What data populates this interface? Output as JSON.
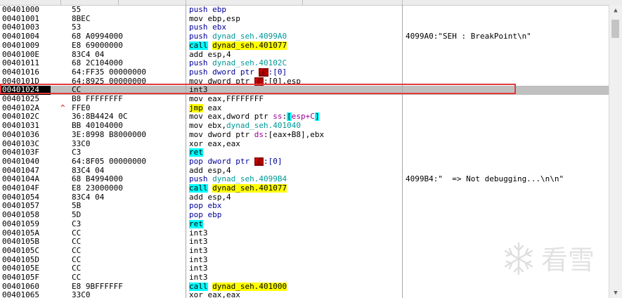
{
  "watermark": {
    "text": "看雪"
  },
  "rows": [
    {
      "addr": "00401000",
      "bytes": "55",
      "instr": [
        {
          "t": "push ebp",
          "c": "t-push"
        }
      ],
      "comment": ""
    },
    {
      "addr": "00401001",
      "bytes": "8BEC",
      "instr": [
        {
          "t": "mov ebp,esp",
          "c": "t-kw"
        }
      ],
      "comment": ""
    },
    {
      "addr": "00401003",
      "bytes": "53",
      "instr": [
        {
          "t": "push ebx",
          "c": "t-push"
        }
      ],
      "comment": ""
    },
    {
      "addr": "00401004",
      "bytes": "68 A0994000",
      "instr": [
        {
          "t": "push ",
          "c": "t-push"
        },
        {
          "t": "dynad_seh.4099A0",
          "c": "t-pushop"
        }
      ],
      "comment": "4099A0:\"SEH : BreakPoint\\n\""
    },
    {
      "addr": "00401009",
      "bytes": "E8 69000000",
      "instr": [
        {
          "t": "call",
          "c": "t-call"
        },
        {
          "t": " ",
          "c": ""
        },
        {
          "t": "dynad_seh.401077",
          "c": "t-dyn"
        }
      ],
      "comment": ""
    },
    {
      "addr": "0040100E",
      "bytes": "83C4 04",
      "instr": [
        {
          "t": "add esp,4",
          "c": "t-kw"
        }
      ],
      "comment": ""
    },
    {
      "addr": "00401011",
      "bytes": "68 2C104000",
      "instr": [
        {
          "t": "push ",
          "c": "t-push"
        },
        {
          "t": "dynad_seh.40102C",
          "c": "t-pushop"
        }
      ],
      "comment": ""
    },
    {
      "addr": "00401016",
      "bytes": "64:FF35 00000000",
      "instr": [
        {
          "t": "push dword ptr ",
          "c": "t-push"
        },
        {
          "t": "fs",
          "c": "t-seg"
        },
        {
          "t": ":[0]",
          "c": "t-push"
        }
      ],
      "comment": ""
    },
    {
      "addr": "0040101D",
      "bytes": "64:8925 00000000",
      "instr": [
        {
          "t": "mov dword ptr ",
          "c": "t-kw"
        },
        {
          "t": "fs",
          "c": "t-seg"
        },
        {
          "t": ":[0],esp",
          "c": "t-kw"
        }
      ],
      "comment": ""
    },
    {
      "addr": "00401024",
      "bytes": "CC",
      "instr": [
        {
          "t": "int3",
          "c": "t-kw"
        }
      ],
      "comment": "",
      "selected": true
    },
    {
      "addr": "00401025",
      "bytes": "B8 FFFFFFFF",
      "instr": [
        {
          "t": "mov eax,FFFFFFFF",
          "c": "t-kw"
        }
      ],
      "comment": ""
    },
    {
      "addr": "0040102A",
      "mark": "^",
      "bytes": "FFE0",
      "instr": [
        {
          "t": "jmp",
          "c": "t-jmp"
        },
        {
          "t": " eax",
          "c": "t-kw"
        }
      ],
      "comment": ""
    },
    {
      "addr": "0040102C",
      "bytes": "36:8B4424 0C",
      "instr": [
        {
          "t": "mov eax,dword ptr ",
          "c": "t-kw"
        },
        {
          "t": "ss",
          "c": "t-mag"
        },
        {
          "t": ":",
          "c": "t-kw"
        },
        {
          "t": "[",
          "c": "t-brk"
        },
        {
          "t": "esp+C",
          "c": "t-mag"
        },
        {
          "t": "]",
          "c": "t-brk"
        }
      ],
      "comment": ""
    },
    {
      "addr": "00401031",
      "bytes": "BB 40104000",
      "instr": [
        {
          "t": "mov ebx,",
          "c": "t-kw"
        },
        {
          "t": "dynad_seh.401040",
          "c": "t-pushop"
        }
      ],
      "comment": ""
    },
    {
      "addr": "00401036",
      "bytes": "3E:8998 B8000000",
      "instr": [
        {
          "t": "mov dword ptr ",
          "c": "t-kw"
        },
        {
          "t": "ds",
          "c": "t-mag"
        },
        {
          "t": ":[eax+B8],ebx",
          "c": "t-kw"
        }
      ],
      "comment": ""
    },
    {
      "addr": "0040103C",
      "bytes": "33C0",
      "instr": [
        {
          "t": "xor eax,eax",
          "c": "t-kw"
        }
      ],
      "comment": ""
    },
    {
      "addr": "0040103F",
      "bytes": "C3",
      "instr": [
        {
          "t": "ret",
          "c": "t-ret"
        }
      ],
      "comment": ""
    },
    {
      "addr": "00401040",
      "bytes": "64:8F05 00000000",
      "instr": [
        {
          "t": "pop dword ptr ",
          "c": "t-push"
        },
        {
          "t": "fs",
          "c": "t-seg"
        },
        {
          "t": ":[0]",
          "c": "t-push"
        }
      ],
      "comment": ""
    },
    {
      "addr": "00401047",
      "bytes": "83C4 04",
      "instr": [
        {
          "t": "add esp,4",
          "c": "t-kw"
        }
      ],
      "comment": ""
    },
    {
      "addr": "0040104A",
      "bytes": "68 B4994000",
      "instr": [
        {
          "t": "push ",
          "c": "t-push"
        },
        {
          "t": "dynad_seh.4099B4",
          "c": "t-pushop"
        }
      ],
      "comment": "4099B4:\"  => Not debugging...\\n\\n\""
    },
    {
      "addr": "0040104F",
      "bytes": "E8 23000000",
      "instr": [
        {
          "t": "call",
          "c": "t-call"
        },
        {
          "t": " ",
          "c": ""
        },
        {
          "t": "dynad_seh.401077",
          "c": "t-dyn"
        }
      ],
      "comment": ""
    },
    {
      "addr": "00401054",
      "bytes": "83C4 04",
      "instr": [
        {
          "t": "add esp,4",
          "c": "t-kw"
        }
      ],
      "comment": ""
    },
    {
      "addr": "00401057",
      "bytes": "5B",
      "instr": [
        {
          "t": "pop ebx",
          "c": "t-push"
        }
      ],
      "comment": ""
    },
    {
      "addr": "00401058",
      "bytes": "5D",
      "instr": [
        {
          "t": "pop ebp",
          "c": "t-push"
        }
      ],
      "comment": ""
    },
    {
      "addr": "00401059",
      "bytes": "C3",
      "instr": [
        {
          "t": "ret",
          "c": "t-ret"
        }
      ],
      "comment": ""
    },
    {
      "addr": "0040105A",
      "bytes": "CC",
      "instr": [
        {
          "t": "int3",
          "c": "t-kw"
        }
      ],
      "comment": ""
    },
    {
      "addr": "0040105B",
      "bytes": "CC",
      "instr": [
        {
          "t": "int3",
          "c": "t-kw"
        }
      ],
      "comment": ""
    },
    {
      "addr": "0040105C",
      "bytes": "CC",
      "instr": [
        {
          "t": "int3",
          "c": "t-kw"
        }
      ],
      "comment": ""
    },
    {
      "addr": "0040105D",
      "bytes": "CC",
      "instr": [
        {
          "t": "int3",
          "c": "t-kw"
        }
      ],
      "comment": ""
    },
    {
      "addr": "0040105E",
      "bytes": "CC",
      "instr": [
        {
          "t": "int3",
          "c": "t-kw"
        }
      ],
      "comment": ""
    },
    {
      "addr": "0040105F",
      "bytes": "CC",
      "instr": [
        {
          "t": "int3",
          "c": "t-kw"
        }
      ],
      "comment": ""
    },
    {
      "addr": "00401060",
      "bytes": "E8 9BFFFFFF",
      "instr": [
        {
          "t": "call",
          "c": "t-call"
        },
        {
          "t": " ",
          "c": ""
        },
        {
          "t": "dynad_seh.401000",
          "c": "t-dyn"
        }
      ],
      "comment": ""
    },
    {
      "addr": "00401065",
      "bytes": "33C0",
      "instr": [
        {
          "t": "xor eax,eax",
          "c": "t-kw"
        }
      ],
      "comment": ""
    }
  ],
  "icons": {
    "scroll_up": "chevron-up-icon",
    "scroll_down": "chevron-down-icon",
    "watermark": "snowflake-icon"
  },
  "colors": {
    "selection": "#c0c0c0",
    "highlight_box": "#e23b3b",
    "call_bg": "#00ffff",
    "symbol_bg": "#ffff00",
    "segment_bg": "#8b0000"
  }
}
